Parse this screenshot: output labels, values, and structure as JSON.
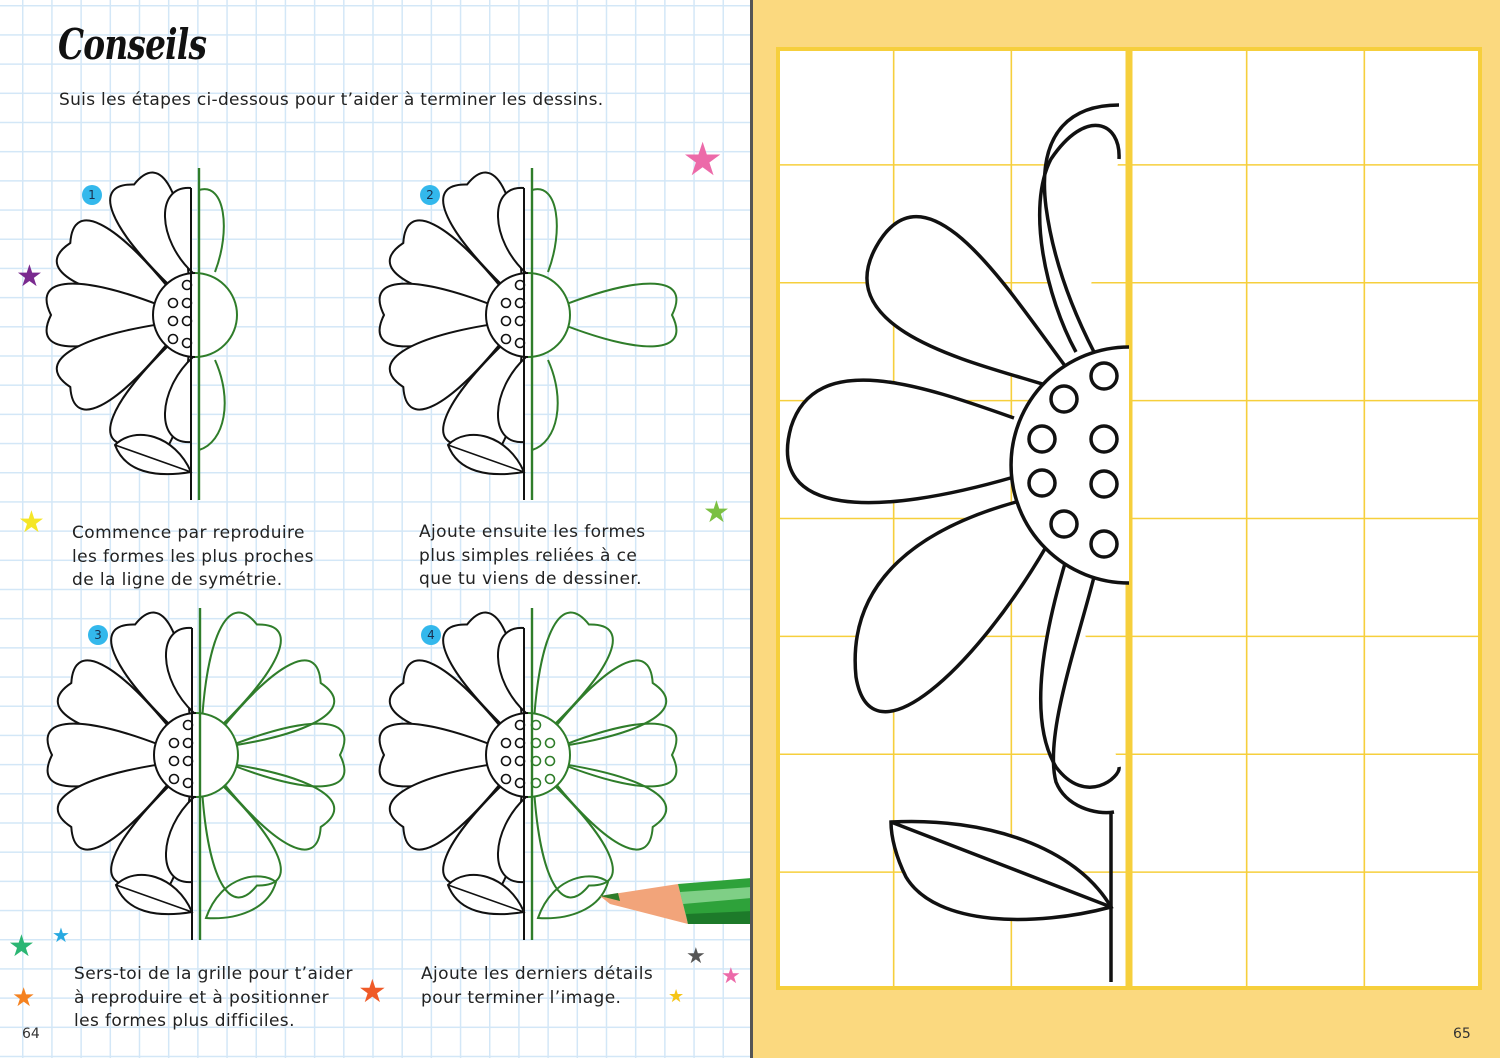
{
  "left_page": {
    "title": "Conseils",
    "intro": "Suis les étapes ci-dessous pour t’aider à terminer les dessins.",
    "page_number": "64",
    "steps": [
      {
        "number": "1",
        "text": "Commence par reproduire\nles formes les plus proches\nde la ligne de symétrie."
      },
      {
        "number": "2",
        "text": "Ajoute ensuite les formes\nplus simples reliées à ce\nque tu viens de dessiner."
      },
      {
        "number": "3",
        "text": "Sers-toi de la grille pour t’aider\nà reproduire et à positionner\nles formes plus difficiles."
      },
      {
        "number": "4",
        "text": "Ajoute les derniers détails\npour terminer l’image."
      }
    ]
  },
  "right_page": {
    "page_number": "65"
  },
  "colors": {
    "step_badge": "#33b8ec",
    "grid_blue": "#d3e7f7",
    "drawing_green": "#2f7d2a",
    "right_background": "#fbd97f",
    "right_grid": "#f6cf3c",
    "pencil_green": "#2ea23a",
    "pencil_wood": "#f2a47a"
  },
  "icons": [
    "star-pink",
    "star-purple",
    "star-yellow",
    "star-green",
    "star-teal",
    "star-orange",
    "star-red",
    "star-grey",
    "colored-pencil"
  ]
}
